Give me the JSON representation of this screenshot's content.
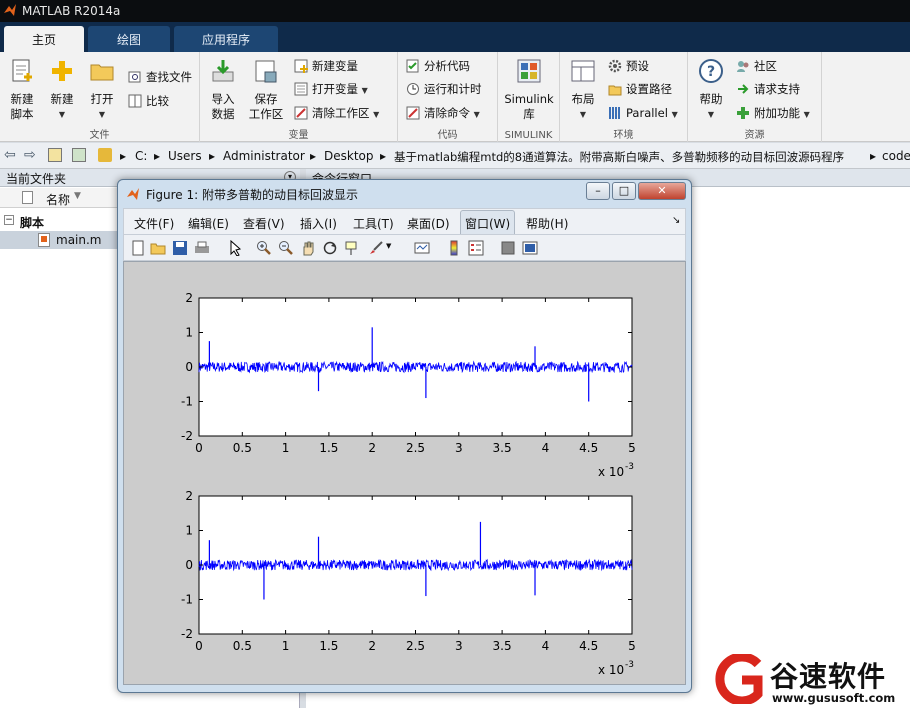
{
  "window": {
    "title": "MATLAB R2014a"
  },
  "tabs": [
    {
      "label": "主页"
    },
    {
      "label": "绘图"
    },
    {
      "label": "应用程序"
    }
  ],
  "ribbon": {
    "file": {
      "label": "文件",
      "new_script": "新建\n脚本",
      "new": "新建",
      "open": "打开",
      "find_files": "查找文件",
      "compare": "比较"
    },
    "variable": {
      "label": "变量",
      "import_data": "导入\n数据",
      "save_workspace": "保存\n工作区",
      "new_variable": "新建变量",
      "open_variable": "打开变量",
      "clear_workspace": "清除工作区"
    },
    "code": {
      "label": "代码",
      "analyze_code": "分析代码",
      "run_and_time": "运行和计时",
      "clear_commands": "清除命令"
    },
    "simulink": {
      "label": "SIMULINK",
      "library": "Simulink\n库"
    },
    "environment": {
      "label": "环境",
      "layout": "布局",
      "preferences": "预设",
      "set_path": "设置路径",
      "parallel": "Parallel"
    },
    "resources": {
      "label": "资源",
      "help": "帮助",
      "community": "社区",
      "request_support": "请求支持",
      "addons": "附加功能"
    }
  },
  "address": {
    "crumbs": [
      "C:",
      "Users",
      "Administrator",
      "Desktop",
      "基于matlab编程mtd的8通道算法。附带高斯白噪声、多普勒频移的动目标回波源码程序",
      "code"
    ]
  },
  "current_folder": {
    "title": "当前文件夹",
    "column_name": "名称",
    "group": "脚本",
    "file": "main.m"
  },
  "command_window": {
    "title": "命令行窗口"
  },
  "figure": {
    "title": "Figure 1: 附带多普勒的动目标回波显示",
    "menu": [
      "文件(F)",
      "编辑(E)",
      "查看(V)",
      "插入(I)",
      "工具(T)",
      "桌面(D)",
      "窗口(W)",
      "帮助(H)"
    ],
    "toolbar_icons": [
      "new-figure-icon",
      "open-file-icon",
      "save-icon",
      "print-icon",
      "arrow-cursor-icon",
      "zoom-in-icon",
      "zoom-out-icon",
      "pan-hand-icon",
      "rotate-3d-icon",
      "data-cursor-icon",
      "brush-icon",
      "link-plot-icon",
      "colorbar-icon",
      "legend-icon",
      "hide-plot-tools-icon",
      "show-plot-tools-icon"
    ]
  },
  "chart_data": [
    {
      "type": "line",
      "color": "#0000ff",
      "x_tick_labels": [
        "0",
        "0.5",
        "1",
        "1.5",
        "2",
        "2.5",
        "3",
        "3.5",
        "4",
        "4.5",
        "5"
      ],
      "y_tick_labels": [
        "-2",
        "-1",
        "0",
        "1",
        "2"
      ],
      "x_exponent": "x 10",
      "x_exponent_power": "-3",
      "xlim": [
        0,
        0.005
      ],
      "ylim": [
        -2,
        2
      ],
      "noise_amplitude": 0.15,
      "spikes": [
        {
          "x": 0.00012,
          "y": 0.75
        },
        {
          "x": 0.00138,
          "y": -0.7
        },
        {
          "x": 0.002,
          "y": 1.15
        },
        {
          "x": 0.00262,
          "y": -0.9
        },
        {
          "x": 0.00388,
          "y": 0.6
        },
        {
          "x": 0.0045,
          "y": -1.0
        }
      ]
    },
    {
      "type": "line",
      "color": "#0000ff",
      "x_tick_labels": [
        "0",
        "0.5",
        "1",
        "1.5",
        "2",
        "2.5",
        "3",
        "3.5",
        "4",
        "4.5",
        "5"
      ],
      "y_tick_labels": [
        "-2",
        "-1",
        "0",
        "1",
        "2"
      ],
      "x_exponent": "x 10",
      "x_exponent_power": "-3",
      "xlim": [
        0,
        0.005
      ],
      "ylim": [
        -2,
        2
      ],
      "noise_amplitude": 0.15,
      "spikes": [
        {
          "x": 0.00012,
          "y": 0.72
        },
        {
          "x": 0.00075,
          "y": -1.0
        },
        {
          "x": 0.00138,
          "y": 0.82
        },
        {
          "x": 0.00262,
          "y": -0.9
        },
        {
          "x": 0.00325,
          "y": 1.25
        },
        {
          "x": 0.00388,
          "y": -0.88
        }
      ]
    }
  ],
  "watermark": {
    "brand": "谷速软件",
    "url": "www.gususoft.com"
  }
}
